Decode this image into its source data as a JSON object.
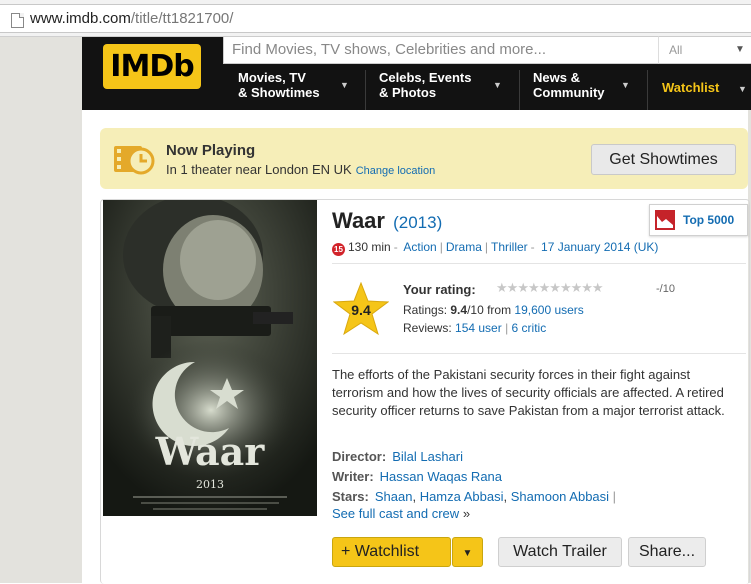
{
  "browser": {
    "url_host": "www.imdb.com",
    "url_path": "/title/tt1821700/"
  },
  "header": {
    "logo_text": "IMDb",
    "search_placeholder": "Find Movies, TV shows, Celebrities and more...",
    "search_category": "All",
    "nav": [
      {
        "line1": "Movies, TV",
        "line2": "& Showtimes"
      },
      {
        "line1": "Celebs, Events",
        "line2": "& Photos"
      },
      {
        "line1": "News &",
        "line2": "Community"
      }
    ],
    "watchlist": "Watchlist"
  },
  "now_playing": {
    "title": "Now Playing",
    "subtitle": "In 1 theater near London EN UK",
    "change_location": "Change location",
    "button": "Get Showtimes"
  },
  "movie": {
    "title": "Waar",
    "year": "(2013)",
    "top_badge": "Top 5000",
    "certificate": "15",
    "runtime": "130 min",
    "genres": [
      "Action",
      "Drama",
      "Thriller"
    ],
    "release_date": "17 January 2014 (UK)",
    "rating_value": "9.4",
    "your_rating_label": "Your rating:",
    "your_rating_value": "-/10",
    "ratings_label": "Ratings:",
    "ratings_score": "9.4",
    "ratings_out_of": "/10 from",
    "ratings_users": "19,600 users",
    "reviews_label": "Reviews:",
    "reviews_user": "154 user",
    "reviews_critic": "6 critic",
    "description": "The efforts of the Pakistani security forces in their fight against terrorism and how the lives of security officials are affected. A retired security officer returns to save Pakistan from a major terrorist attack.",
    "director_label": "Director:",
    "director": "Bilal Lashari",
    "writer_label": "Writer:",
    "writer": "Hassan Waqas Rana",
    "stars_label": "Stars:",
    "stars": [
      "Shaan",
      "Hamza Abbasi",
      "Shamoon Abbasi"
    ],
    "full_cast": "See full cast and crew",
    "poster_title": "Waar",
    "poster_year": "2013"
  },
  "actions": {
    "watchlist": "+ Watchlist",
    "watch_trailer": "Watch Trailer",
    "share": "Share..."
  },
  "colors": {
    "imdb_yellow": "#f5c518",
    "header_bg": "#121212",
    "link_blue": "#136cb2",
    "now_playing_bg": "#f6eeb8",
    "gutter": "#e3e2dd"
  }
}
